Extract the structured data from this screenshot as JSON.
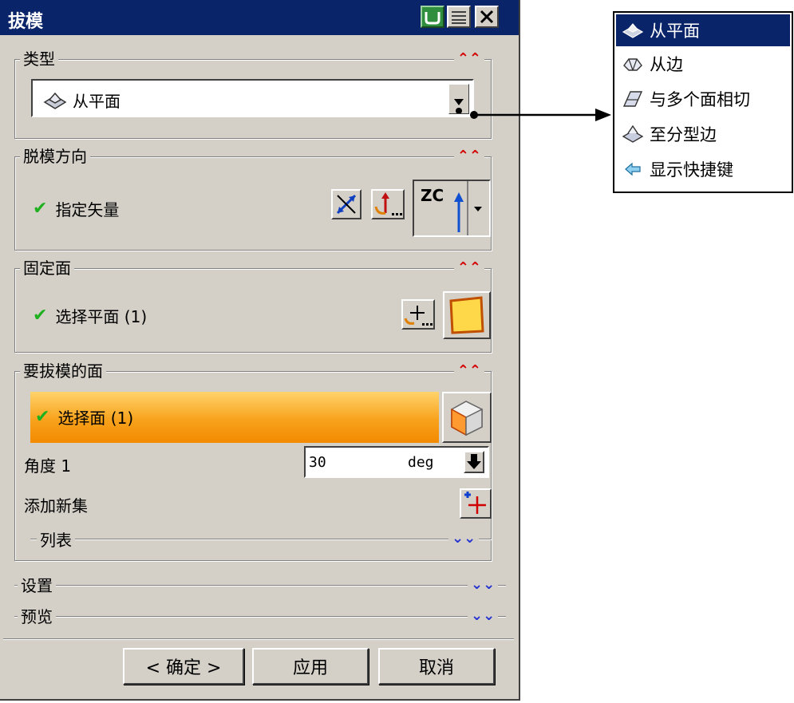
{
  "dialog": {
    "title": "拔模"
  },
  "groups": {
    "type": {
      "label": "类型",
      "selected": "从平面"
    },
    "direction": {
      "label": "脱模方向",
      "row_label": "指定矢量",
      "vector": "ZC"
    },
    "fixed": {
      "label": "固定面",
      "row_label": "选择平面 (1)"
    },
    "faces": {
      "label": "要拔模的面",
      "row_label": "选择面 (1)",
      "angle_label": "角度 1",
      "angle_value": "30",
      "angle_unit": "deg",
      "add_set_label": "添加新集",
      "list_label": "列表"
    },
    "settings": {
      "label": "设置"
    },
    "preview": {
      "label": "预览"
    }
  },
  "buttons": {
    "ok": "< 确定 >",
    "apply": "应用",
    "cancel": "取消"
  },
  "popup_menu": {
    "items": [
      {
        "label": "从平面",
        "icon": "from-plane-icon"
      },
      {
        "label": "从边",
        "icon": "from-edge-icon"
      },
      {
        "label": "与多个面相切",
        "icon": "tangent-faces-icon"
      },
      {
        "label": "至分型边",
        "icon": "parting-edge-icon"
      },
      {
        "label": "显示快捷键",
        "icon": "arrow-left-icon"
      }
    ]
  },
  "colors": {
    "title_bar": "#0a246a",
    "dialog_bg": "#d4d0c8",
    "highlight_orange": "#f8a21c",
    "check_green": "#1fb01f",
    "collapse_red": "#d40000"
  }
}
